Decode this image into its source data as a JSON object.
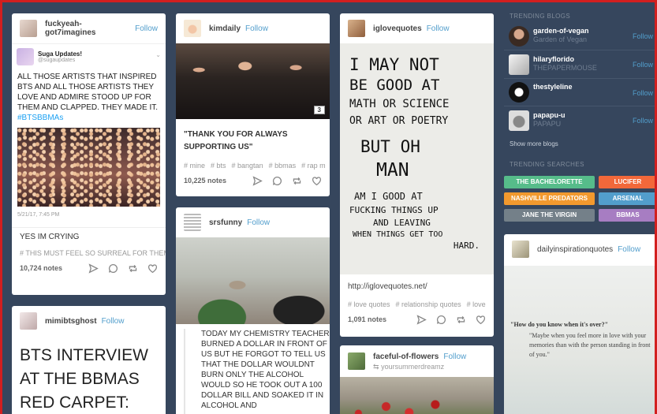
{
  "column1": {
    "post1": {
      "username": "fuckyeah-got7imagines",
      "follow": "Follow",
      "embed_name": "Suga Updates!",
      "embed_handle": "@sugaupdates",
      "body": "ALL THOSE ARTISTS THAT INSPIRED BTS AND ALL THOSE ARTISTS THEY LOVE AND ADMIRE STOOD UP FOR THEM AND CLAPPED. THEY MADE IT.",
      "hashtag": "#BTSBBMAs",
      "date": "5/21/17, 7:45 PM",
      "comment": "YES IM CRYING",
      "tag": "# THIS MUST FEEL SO SURREAL FOR THEM",
      "notes": "10,724 notes"
    },
    "post2": {
      "username": "mimibtsghost",
      "follow": "Follow",
      "title": "BTS INTERVIEW AT THE BBMAS RED CARPET:"
    }
  },
  "column2": {
    "post1": {
      "username": "kimdaily",
      "follow": "Follow",
      "photo_count": "3",
      "quote": "\"THANK YOU FOR ALWAYS SUPPORTING US\"",
      "tags": [
        "# mine",
        "# bts",
        "# bangtan",
        "# bbmas",
        "# rap m"
      ],
      "notes": "10,225 notes"
    },
    "post2": {
      "username": "srsfunny",
      "follow": "Follow",
      "body": "TODAY MY CHEMISTRY TEACHER BURNED A DOLLAR IN FRONT OF US BUT HE FORGOT TO TELL US THAT THE DOLLAR WOULDNT BURN ONLY THE ALCOHOL WOULD SO HE TOOK OUT A 100 DOLLAR BILL AND SOAKED IT IN ALCOHOL AND"
    }
  },
  "column3": {
    "post1": {
      "username": "iglovequotes",
      "follow": "Follow",
      "handwriting": [
        "I MAY NOT",
        "BE GOOD AT",
        "MATH OR SCIENCE",
        "OR ART OR POETRY",
        "BUT OH",
        "MAN",
        "AM I GOOD AT",
        "FUCKING THINGS UP",
        "AND LEAVING",
        "WHEN THINGS GET TOO",
        "HARD."
      ],
      "link": "http://iglovequotes.net/",
      "tags": [
        "# love quotes",
        "# relationship quotes",
        "# love"
      ],
      "notes": "1,091 notes"
    },
    "post2": {
      "username": "faceful-of-flowers",
      "follow": "Follow",
      "reblog_from": "yoursummerdreamz"
    }
  },
  "sidebar": {
    "trending_blogs_title": "TRENDING BLOGS",
    "blogs": [
      {
        "name": "garden-of-vegan",
        "subtitle": "Garden of Vegan",
        "follow": "Follow"
      },
      {
        "name": "hilaryflorido",
        "subtitle": "THEPAPERMOUSE",
        "follow": "Follow"
      },
      {
        "name": "thestyleline",
        "subtitle": "",
        "follow": "Follow"
      },
      {
        "name": "papapu-u",
        "subtitle": "PAPAPU",
        "follow": "Follow"
      }
    ],
    "show_more": "Show more blogs",
    "trending_searches_title": "TRENDING SEARCHES",
    "searches": [
      {
        "label": "THE BACHELORETTE",
        "color": "#56bc8a"
      },
      {
        "label": "LUCIFER",
        "color": "#f2683a"
      },
      {
        "label": "NASHVILLE PREDATORS",
        "color": "#f2992e"
      },
      {
        "label": "ARSENAL",
        "color": "#529ecc"
      },
      {
        "label": "JANE THE VIRGIN",
        "color": "#748089"
      },
      {
        "label": "BBMAS",
        "color": "#a77dc2"
      }
    ],
    "promo": {
      "username": "dailyinspirationquotes",
      "follow": "Follow",
      "heading": "\"How do you know when it's over?\"",
      "body": "\"Maybe when you feel more in love with your memories than with the person standing in front of you.\""
    }
  },
  "colors": {
    "background": "#36465d",
    "accent": "#529ecc",
    "frame": "#d21f1f"
  }
}
